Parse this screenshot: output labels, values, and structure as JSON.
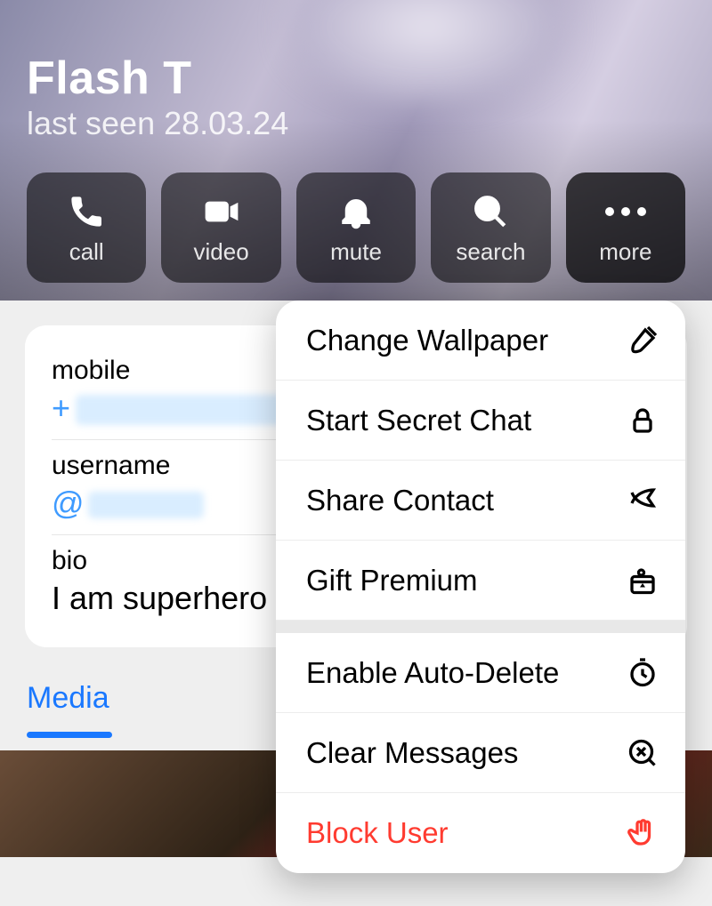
{
  "header": {
    "contact_name": "Flash T",
    "last_seen": "last seen 28.03.24"
  },
  "actions": {
    "call": "call",
    "video": "video",
    "mute": "mute",
    "search": "search",
    "more": "more"
  },
  "info": {
    "mobile_label": "mobile",
    "mobile_value": "+",
    "username_label": "username",
    "username_value": "@",
    "bio_label": "bio",
    "bio_value": "I am superhero"
  },
  "tabs": {
    "media": "Media"
  },
  "more_menu": {
    "change_wallpaper": "Change Wallpaper",
    "start_secret_chat": "Start Secret Chat",
    "share_contact": "Share Contact",
    "gift_premium": "Gift Premium",
    "enable_auto_delete": "Enable Auto-Delete",
    "clear_messages": "Clear Messages",
    "block_user": "Block User"
  }
}
